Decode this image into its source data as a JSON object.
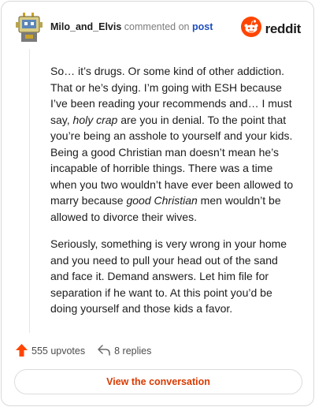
{
  "header": {
    "author": "Milo_and_Elvis",
    "commented_text": "commented on",
    "post_link": "post",
    "brand": "reddit",
    "avatar_icon": "robot-avatar-icon",
    "brand_color": "#ff4500"
  },
  "comment": {
    "p1_a": "So… it’s drugs. Or some kind of other addiction. That or he’s dying. I’m going with ESH because I’ve been reading your recommends and… I must say, ",
    "p1_em1": "holy crap",
    "p1_b": " are you in denial. To the point that you’re being an asshole to yourself and your kids. Being a good Christian man doesn’t mean he’s incapable of horrible things. There was a time when you two wouldn’t have ever been allowed to marry because ",
    "p1_em2": "good Christian",
    "p1_c": " men wouldn’t be allowed to divorce their wives.",
    "p2": "Seriously, something is very wrong in your home and you need to pull your head out of the sand and face it. Demand answers. Let him file for separation if he want to. At this point you’d be doing yourself and those kids a favor."
  },
  "actions": {
    "upvotes": "555 upvotes",
    "replies": "8 replies",
    "upvote_color": "#ff4500"
  },
  "cta": {
    "label": "View the conversation",
    "color": "#d93a00"
  }
}
